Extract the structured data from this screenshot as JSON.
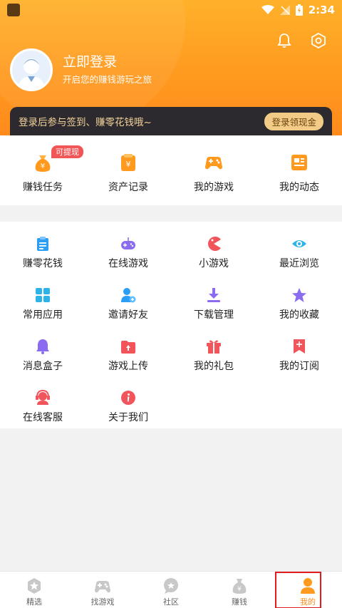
{
  "status_bar": {
    "time": "2:34"
  },
  "header": {
    "login_title": "立即登录",
    "login_subtitle": "开启您的赚钱游玩之旅",
    "banner_text": "登录后参与签到、赚零花钱哦~",
    "banner_button": "登录领现金"
  },
  "quick_actions": [
    {
      "label": "赚钱任务",
      "badge": "可提现",
      "icon": "money-bag-icon"
    },
    {
      "label": "资产记录",
      "icon": "wallet-icon"
    },
    {
      "label": "我的游戏",
      "icon": "gamepad-icon"
    },
    {
      "label": "我的动态",
      "icon": "feed-icon"
    }
  ],
  "features": [
    {
      "label": "赚零花钱",
      "icon": "clipboard-icon"
    },
    {
      "label": "在线游戏",
      "icon": "controller-icon"
    },
    {
      "label": "小游戏",
      "icon": "pacman-icon"
    },
    {
      "label": "最近浏览",
      "icon": "eye-icon"
    },
    {
      "label": "常用应用",
      "icon": "apps-grid-icon"
    },
    {
      "label": "邀请好友",
      "icon": "add-friend-icon"
    },
    {
      "label": "下载管理",
      "icon": "download-icon"
    },
    {
      "label": "我的收藏",
      "icon": "star-icon"
    },
    {
      "label": "消息盒子",
      "icon": "bell-icon"
    },
    {
      "label": "游戏上传",
      "icon": "upload-folder-icon"
    },
    {
      "label": "我的礼包",
      "icon": "gift-icon"
    },
    {
      "label": "我的订阅",
      "icon": "bookmark-icon"
    },
    {
      "label": "在线客服",
      "icon": "headset-icon"
    },
    {
      "label": "关于我们",
      "icon": "info-icon"
    }
  ],
  "bottom_nav": [
    {
      "label": "精选",
      "icon": "star-badge-icon",
      "active": false
    },
    {
      "label": "找游戏",
      "icon": "gamepad-nav-icon",
      "active": false
    },
    {
      "label": "社区",
      "icon": "chat-bubble-icon",
      "active": false
    },
    {
      "label": "赚钱",
      "icon": "money-bag-nav-icon",
      "active": false
    },
    {
      "label": "我的",
      "icon": "person-icon",
      "active": true
    }
  ],
  "colors": {
    "brand_orange": "#ff9a1f",
    "banner_dark": "#2d2a2f",
    "banner_gold": "#f2cc86",
    "badge_red": "#f25555",
    "active_outline": "#e01b1b"
  }
}
